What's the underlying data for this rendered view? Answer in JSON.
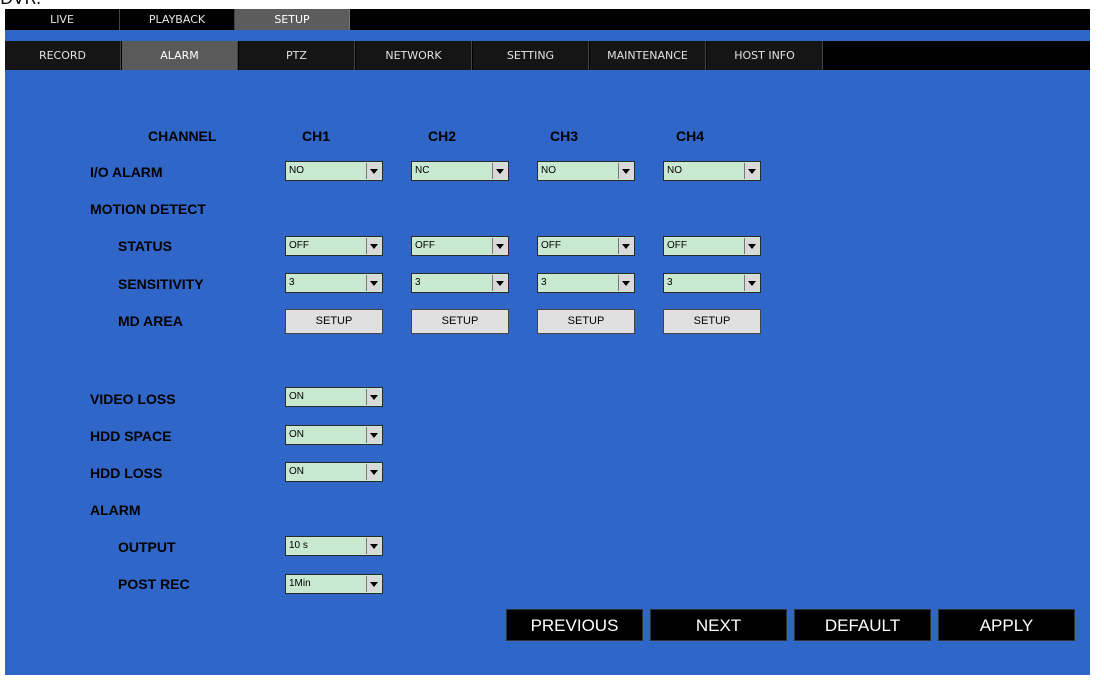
{
  "cut_text": "DVR:",
  "top_tabs": [
    "LIVE",
    "PLAYBACK",
    "SETUP"
  ],
  "sub_tabs": [
    "RECORD",
    "ALARM",
    "PTZ",
    "NETWORK",
    "SETTING",
    "MAINTENANCE",
    "HOST INFO"
  ],
  "labels": {
    "channel": "CHANNEL",
    "io_alarm": "I/O ALARM",
    "motion_detect": "MOTION DETECT",
    "status": "STATUS",
    "sensitivity": "SENSITIVITY",
    "md_area": "MD AREA",
    "video_loss": "VIDEO LOSS",
    "hdd_space": "HDD SPACE",
    "hdd_loss": "HDD LOSS",
    "alarm": "ALARM",
    "output": "OUTPUT",
    "post_rec": "POST REC"
  },
  "channels": [
    "CH1",
    "CH2",
    "CH3",
    "CH4"
  ],
  "io_alarm_values": [
    "NO",
    "NC",
    "NO",
    "NO"
  ],
  "status_values": [
    "OFF",
    "OFF",
    "OFF",
    "OFF"
  ],
  "sensitivity_values": [
    "3",
    "3",
    "3",
    "3"
  ],
  "md_area_button": "SETUP",
  "video_loss": "ON",
  "hdd_space": "ON",
  "hdd_loss": "ON",
  "output": "10 s",
  "post_rec": "1Min",
  "actions": {
    "previous": "PREVIOUS",
    "next": "NEXT",
    "default": "DEFAULT",
    "apply": "APPLY"
  }
}
